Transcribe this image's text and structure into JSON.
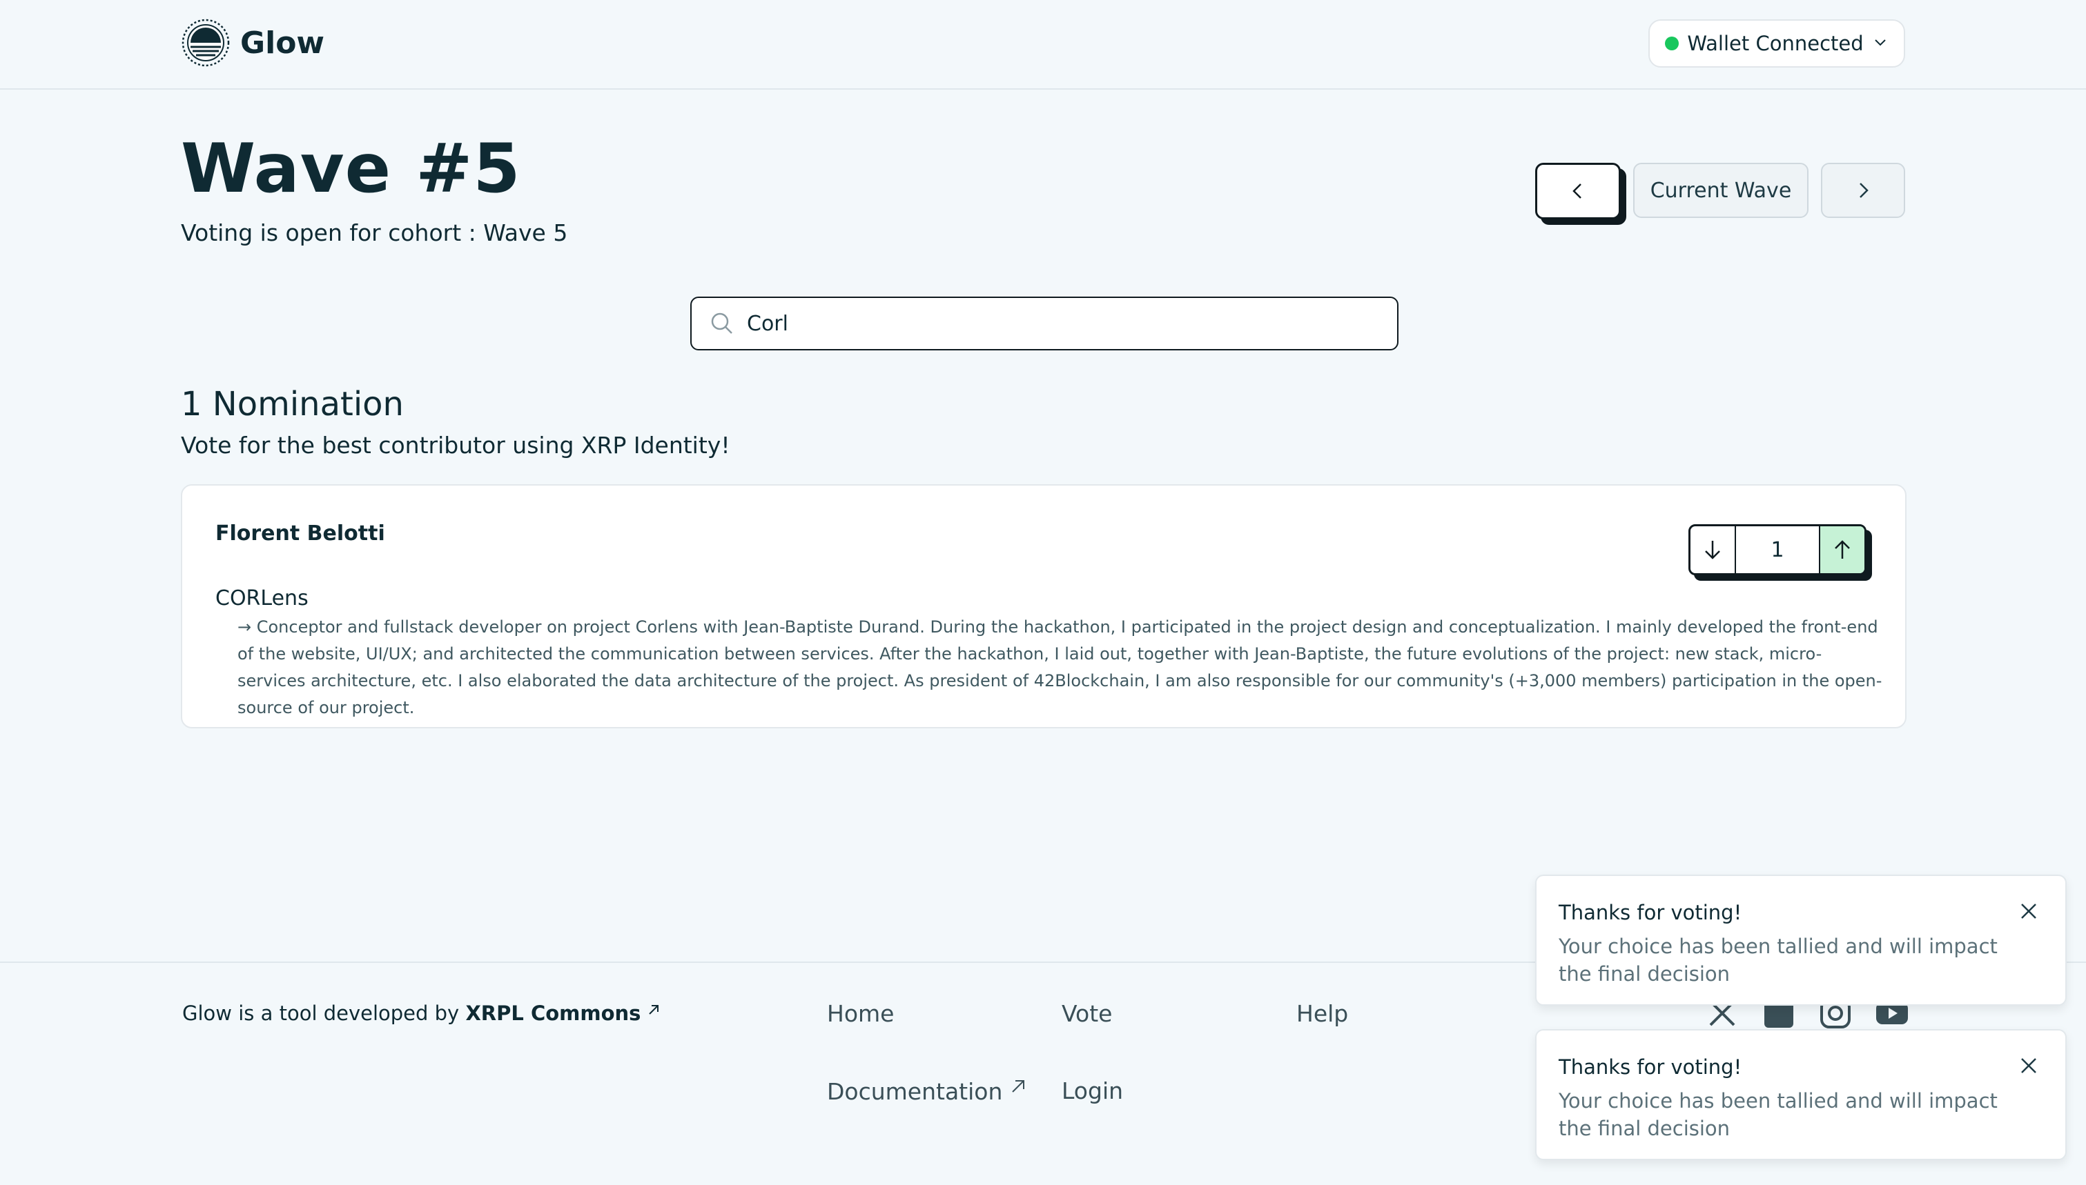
{
  "header": {
    "brand": "Glow",
    "wallet_label": "Wallet Connected",
    "wallet_status_color": "#18c75d"
  },
  "page": {
    "title": "Wave #5",
    "subtitle": "Voting is open for cohort : Wave 5"
  },
  "wave_nav": {
    "current_label": "Current Wave"
  },
  "search": {
    "value": "Corl"
  },
  "nominations": {
    "count_label": "1 Nomination",
    "subtitle": "Vote for the best contributor using XRP Identity!",
    "items": [
      {
        "name": "Florent Belotti",
        "project": "CORLens",
        "description": "→ Conceptor and fullstack developer on project Corlens with Jean-Baptiste Durand. During the hackathon, I participated in the project design and conceptualization. I mainly developed the front-end of the website, UI/UX; and architected the communication between services. After the hackathon, I laid out, together with Jean-Baptiste, the future evolutions of the project: new stack, micro-services architecture, etc. I also elaborated the data architecture of the project. As president of 42Blockchain, I am also responsible for our community's (+3,000 members) participation in the open-source of our project.",
        "votes": "1"
      }
    ]
  },
  "footer": {
    "credit_prefix": "Glow is a tool developed by",
    "credit_org": "XRPL Commons",
    "links": {
      "home": "Home",
      "vote": "Vote",
      "help": "Help",
      "documentation": "Documentation",
      "login": "Login"
    }
  },
  "toasts": [
    {
      "title": "Thanks for voting!",
      "message": "Your choice has been tallied and will impact the final decision"
    },
    {
      "title": "Thanks for voting!",
      "message": "Your choice has been tallied and will impact the final decision"
    }
  ],
  "colors": {
    "background": "#f3f8fb",
    "text": "#0f2a33",
    "upvote_bg": "#c6f2d6"
  }
}
